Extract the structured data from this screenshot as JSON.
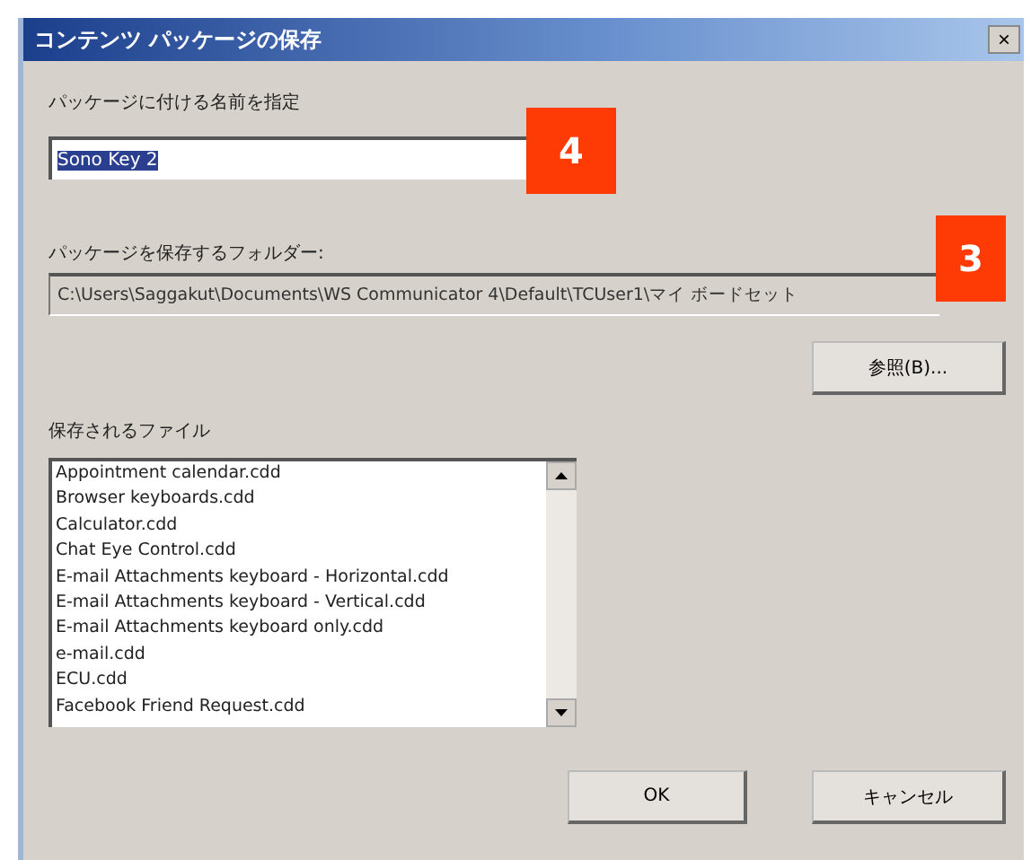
{
  "window": {
    "title": "コンテンツ パッケージの保存",
    "close": "×"
  },
  "name_label": "パッケージに付ける名前を指定",
  "name_field": {
    "value": "Sono Key 2",
    "selected": true
  },
  "badges": [
    {
      "text": "4"
    },
    {
      "text": "3"
    }
  ],
  "folder_label": "パッケージを保存するフォルダー:",
  "folder_path": "C:\\Users\\Saggakut\\Documents\\WS Communicator 4\\Default\\TCUser1\\マイ ボードセット",
  "browse_button": "参照(B)...",
  "files_label": "保存されるファイル",
  "files": [
    "Appointment calendar.cdd",
    "Browser keyboards.cdd",
    "Calculator.cdd",
    "Chat Eye Control.cdd",
    "E-mail Attachments keyboard - Horizontal.cdd",
    "E-mail Attachments keyboard - Vertical.cdd",
    "E-mail Attachments keyboard only.cdd",
    "e-mail.cdd",
    "ECU.cdd",
    "Facebook Friend Request.cdd"
  ],
  "buttons": [
    "OK",
    "キャンセル"
  ]
}
